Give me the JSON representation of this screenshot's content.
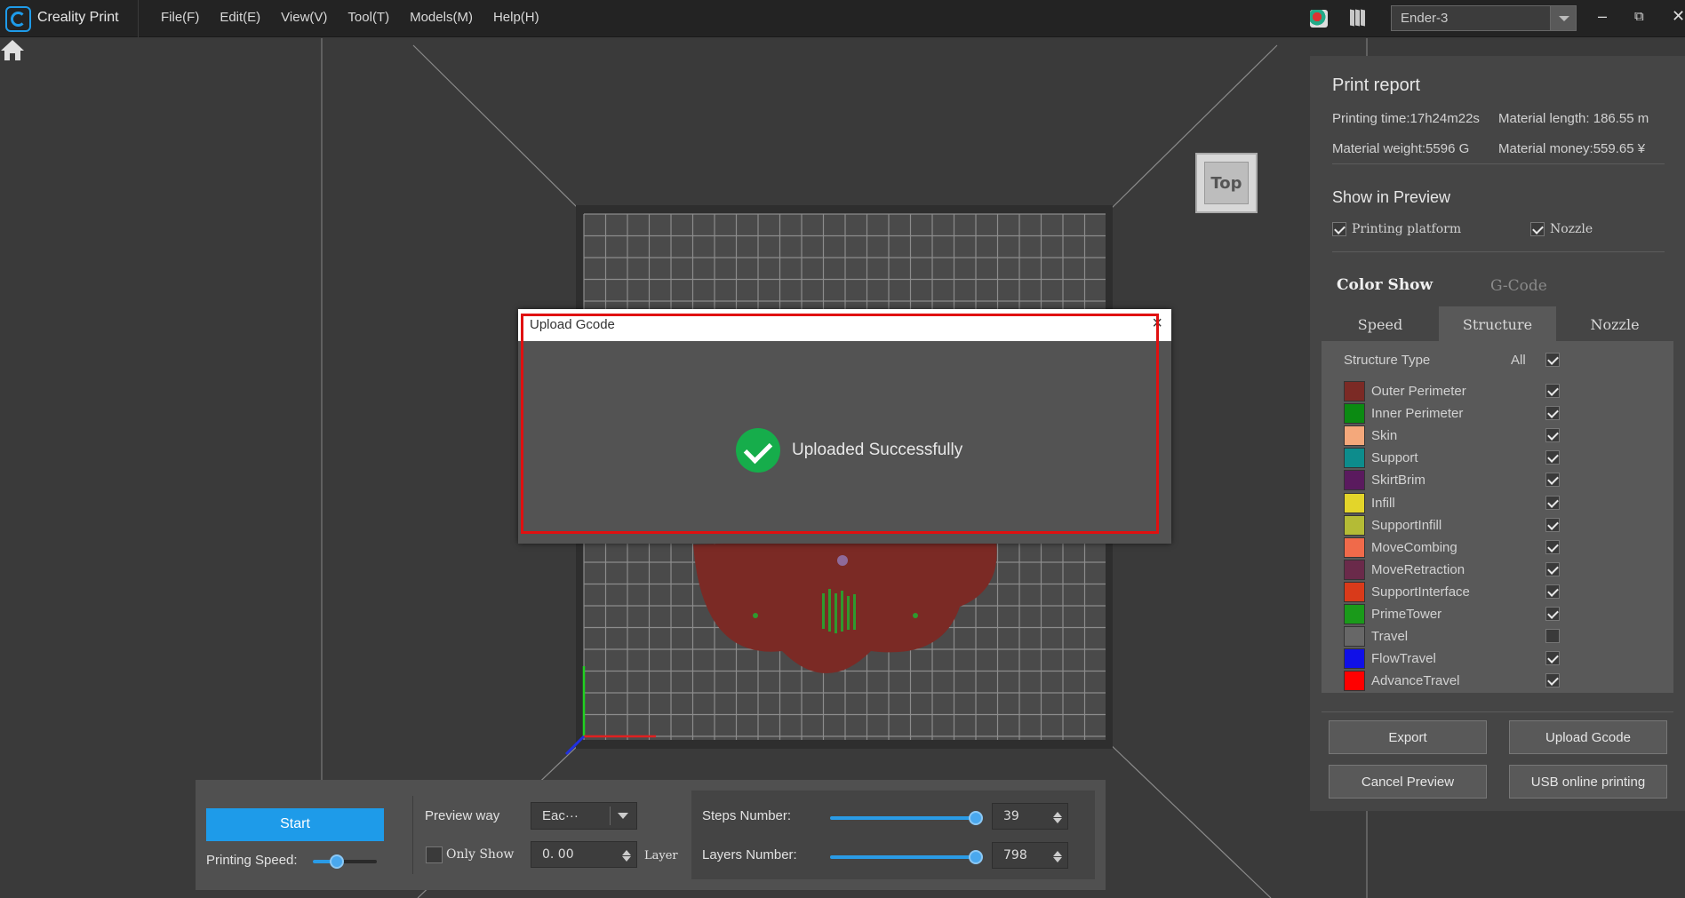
{
  "app": {
    "title": "Creality Print",
    "menu": [
      "File(F)",
      "Edit(E)",
      "View(V)",
      "Tool(T)",
      "Models(M)",
      "Help(H)"
    ],
    "printer": "Ender-3",
    "window_controls": {
      "minimize": "–",
      "restore": "⧉",
      "close": "✕"
    }
  },
  "viewport": {
    "view_cube_label": "Top"
  },
  "dialog": {
    "title": "Upload Gcode",
    "close": "×",
    "message": "Uploaded Successfully"
  },
  "report": {
    "title": "Print report",
    "printing_time": "Printing time:17h24m22s",
    "material_length": "Material length: 186.55 m",
    "material_weight": "Material weight:5596 G",
    "material_money": "Material money:559.65 ¥",
    "show_in_preview": "Show in Preview",
    "printing_platform": "Printing platform",
    "nozzle": "Nozzle",
    "color_show": "Color Show",
    "gcode": "G-Code",
    "tabs": [
      "Speed",
      "Structure",
      "Nozzle"
    ],
    "structure_type": "Structure Type",
    "all": "All",
    "structures": [
      {
        "name": "Outer Perimeter",
        "color": "#7b2a25",
        "checked": true
      },
      {
        "name": "Inner Perimeter",
        "color": "#0b8a12",
        "checked": true
      },
      {
        "name": "Skin",
        "color": "#f4a87b",
        "checked": true
      },
      {
        "name": "Support",
        "color": "#0d8c8c",
        "checked": true
      },
      {
        "name": "SkirtBrim",
        "color": "#5a1a5e",
        "checked": true
      },
      {
        "name": "Infill",
        "color": "#e3d52a",
        "checked": true
      },
      {
        "name": "SupportInfill",
        "color": "#b4bb36",
        "checked": true
      },
      {
        "name": "MoveCombing",
        "color": "#f06a4a",
        "checked": true
      },
      {
        "name": "MoveRetraction",
        "color": "#6a2a4a",
        "checked": true
      },
      {
        "name": "SupportInterface",
        "color": "#d93a1a",
        "checked": true
      },
      {
        "name": "PrimeTower",
        "color": "#1a9a1a",
        "checked": true
      },
      {
        "name": "Travel",
        "color": "#676767",
        "checked": false
      },
      {
        "name": "FlowTravel",
        "color": "#1010e8",
        "checked": true
      },
      {
        "name": "AdvanceTravel",
        "color": "#ff0000",
        "checked": true
      }
    ],
    "buttons": {
      "export": "Export",
      "upload": "Upload Gcode",
      "cancel": "Cancel Preview",
      "usb": "USB online printing"
    }
  },
  "bottom": {
    "start": "Start",
    "printing_speed": "Printing Speed:",
    "printing_speed_level": 0.38,
    "preview_way": "Preview way",
    "preview_value": "Eac···",
    "only_show": "Only Show",
    "layer_value": "0. 00",
    "layer": "Layer",
    "steps_number": "Steps Number:",
    "steps_value": "39",
    "layers_number": "Layers Number:",
    "layers_value": "798"
  },
  "colors": {
    "accent": "#1e9be9",
    "success": "#16ad4b",
    "highlight": "#e01010"
  }
}
